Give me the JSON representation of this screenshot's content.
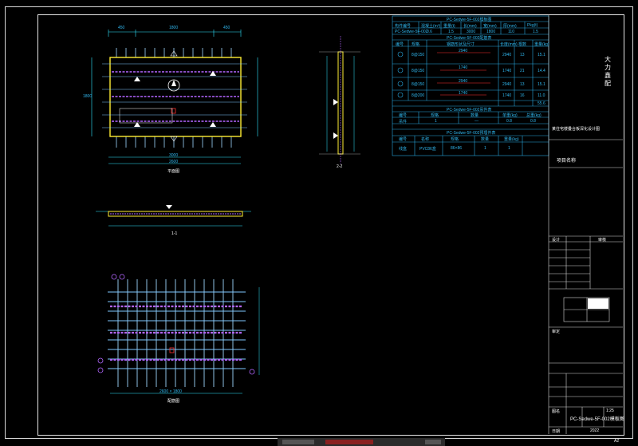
{
  "drawing": {
    "plan_title": "平面图",
    "rebar_title": "配筋图",
    "section_1": "1-1",
    "section_2": "2-2",
    "plan_dims": {
      "top_left": "450",
      "top_mid": "1800",
      "top_right": "450",
      "overall_w": "3000",
      "inner_w": "2600",
      "side_h": "1800"
    },
    "rebar_dim": "2600 × 1800"
  },
  "tables": {
    "t1_title": "PC-Sedwe-5F-002模板图",
    "t1_headers": [
      "构件编号",
      "混凝土(m³)",
      "重量(t)",
      "长(mm)",
      "宽(mm)",
      "厚(mm)",
      "Pkg(t)"
    ],
    "t1_row": [
      "PC-Sedwe-5F-002",
      "0.6",
      "1.5",
      "3000",
      "1800",
      "110",
      "1.5"
    ],
    "t2_title": "PC-Sedwe-5F-002配筋表",
    "t2_headers": [
      "编号",
      "规格",
      "钢筋形状及尺寸",
      "长度(mm)",
      "根数",
      "重量(kg)"
    ],
    "t2_rows": [
      [
        "①",
        "8@150",
        "2940",
        "2940",
        "13",
        "15.1"
      ],
      [
        "②",
        "8@150",
        "1740",
        "1740",
        "21",
        "14.4"
      ],
      [
        "③",
        "8@150",
        "2940",
        "2940",
        "13",
        "15.1"
      ],
      [
        "④",
        "8@200",
        "1740",
        "1740",
        "16",
        "11.0"
      ]
    ],
    "t2_total": "55.6",
    "t3_title": "PC-Sedwe-5F-002吊件表",
    "t3_headers": [
      "编号",
      "规格",
      "数量",
      "单重(kg)",
      "总重(kg)"
    ],
    "t3_row": [
      "吊件",
      "1",
      "—",
      "0.8",
      "0.8"
    ],
    "t4_title": "PC-Sedwe-5F-002预埋件表",
    "t4_headers": [
      "编号",
      "名称",
      "规格",
      "数量",
      "重量(kg)"
    ],
    "t4_row": [
      "线盒",
      "PVC86盒",
      "86×86",
      "1",
      "1"
    ]
  },
  "title_block": {
    "company": [
      "大",
      "力",
      "鑫",
      "配"
    ],
    "project_label": "项目名称",
    "note": "某住宅楼叠合板深化设计图",
    "design_label": "设计",
    "check_label": "审核",
    "approve_label": "审定",
    "scale": "1:25",
    "drawing_no_label": "图名",
    "drawing_name": "PC-Sedwe-5F-002模板图",
    "date_label": "日期",
    "date": "2022",
    "sheet_label": "图号",
    "page": "A2"
  },
  "status": {
    "tabs": [
      "模型",
      "布局1"
    ],
    "zoom": "1:1"
  }
}
